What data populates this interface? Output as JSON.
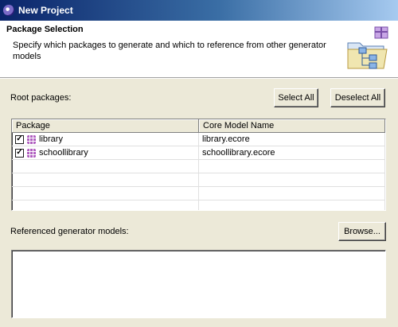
{
  "window": {
    "title": "New Project"
  },
  "banner": {
    "title": "Package Selection",
    "description": "Specify which packages to generate and which to reference from other generator models",
    "icon": "wizard-banner-icon"
  },
  "root_packages": {
    "label": "Root packages:",
    "select_all_label": "Select All",
    "deselect_all_label": "Deselect All",
    "columns": [
      "Package",
      "Core Model Name"
    ],
    "rows": [
      {
        "package": "library",
        "core_model": "library.ecore",
        "checked": true
      },
      {
        "package": "schoollibrary",
        "core_model": "schoollibrary.ecore",
        "checked": true
      }
    ]
  },
  "referenced": {
    "label": "Referenced generator models:",
    "browse_label": "Browse..."
  }
}
